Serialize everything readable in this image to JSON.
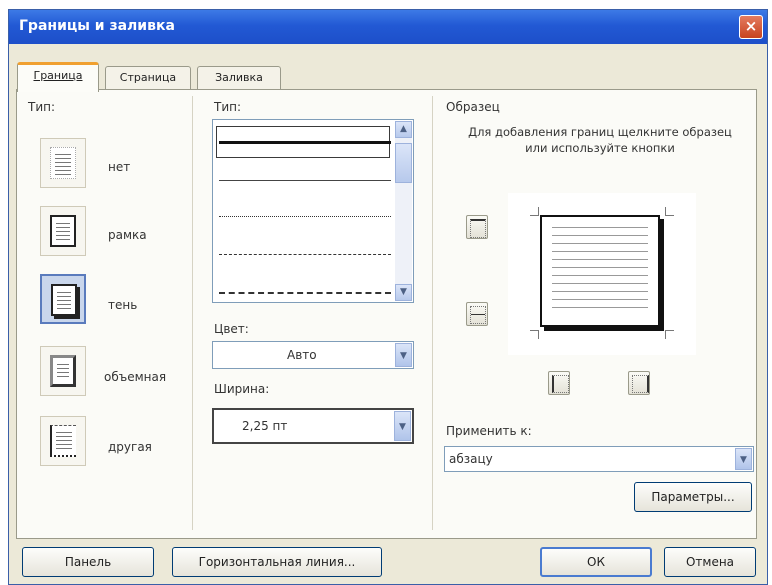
{
  "dialog": {
    "title": "Границы и заливка",
    "close_label": "×"
  },
  "tabs": [
    {
      "label": "Граница"
    },
    {
      "label": "Страница"
    },
    {
      "label": "Заливка"
    }
  ],
  "type_section": {
    "label": "Тип:",
    "options": [
      {
        "label": "нет",
        "icon": "border-none-icon"
      },
      {
        "label": "рамка",
        "icon": "border-box-icon"
      },
      {
        "label": "тень",
        "icon": "border-shadow-icon",
        "selected": true
      },
      {
        "label": "объемная",
        "icon": "border-3d-icon"
      },
      {
        "label": "другая",
        "icon": "border-custom-icon"
      }
    ]
  },
  "line_section": {
    "type_label": "Тип:",
    "color_label": "Цвет:",
    "color_value": "Авто",
    "width_label": "Ширина:",
    "width_value": "2,25 пт"
  },
  "preview_section": {
    "label": "Образец",
    "hint": "Для добавления границ щелкните образец или используйте кнопки",
    "apply_label": "Применить к:",
    "apply_value": "абзацу",
    "options_button": "Параметры..."
  },
  "footer": {
    "panel_button": "Панель",
    "hline_button": "Горизонтальная линия...",
    "ok_button": "ОК",
    "cancel_button": "Отмена"
  },
  "colors": {
    "titlebar": "#2259d4",
    "dialog_bg": "#ece9d8",
    "active_tab_accent": "#f0a030"
  }
}
